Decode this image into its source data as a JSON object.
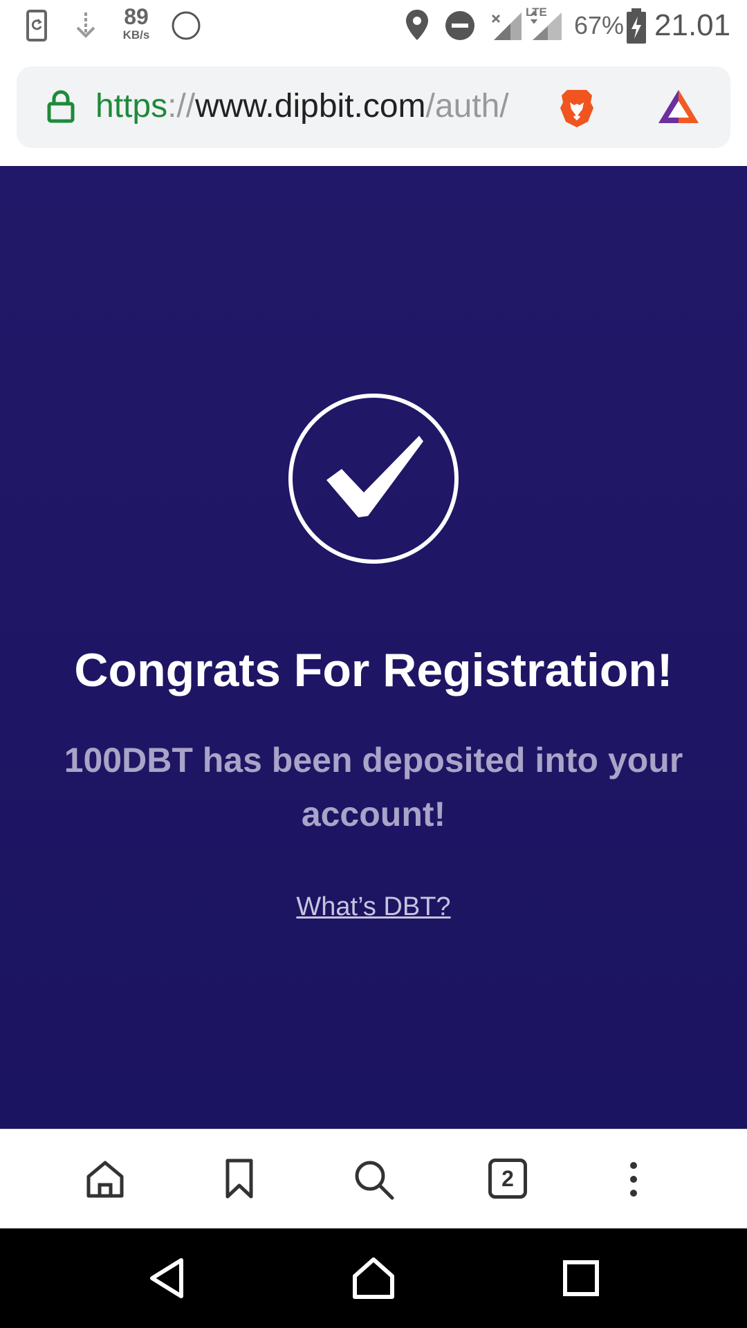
{
  "status_bar": {
    "net_speed": "89",
    "net_speed_unit": "KB/s",
    "network_type": "LTE",
    "battery": "67%",
    "time": "21.01",
    "icons": [
      "screenshot-icon",
      "download-icon",
      "circle-icon",
      "location-icon",
      "do-not-disturb-icon",
      "signal-icon",
      "battery-charging-icon"
    ]
  },
  "url_bar": {
    "scheme": "https",
    "separator": "://",
    "host": "www.dipbit.com",
    "path": "/auth/",
    "icons": [
      "lock-icon",
      "brave-shields-icon",
      "brave-rewards-icon"
    ]
  },
  "page": {
    "title": "Congrats For Registration!",
    "subtitle": "100DBT has been deposited into your account!",
    "link": "What’s DBT?",
    "icon": "checkmark-circle-icon",
    "colors": {
      "background": "#1e1664",
      "title": "#ffffff",
      "subtitle": "#a9a4c8"
    }
  },
  "toolbar": {
    "tab_count": "2",
    "icons": [
      "home-icon",
      "bookmark-icon",
      "search-icon",
      "tabs-icon",
      "more-icon"
    ]
  },
  "system_nav": {
    "icons": [
      "back-icon",
      "home-nav-icon",
      "recents-icon"
    ]
  }
}
